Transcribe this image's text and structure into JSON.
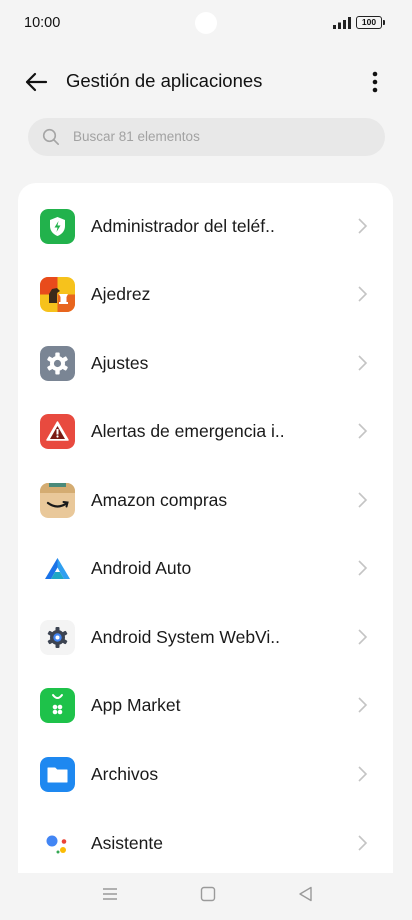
{
  "status": {
    "time": "10:00",
    "battery": "100"
  },
  "header": {
    "title": "Gestión de aplicaciones"
  },
  "search": {
    "placeholder": "Buscar 81 elementos"
  },
  "apps": [
    {
      "label": "Administrador del teléf..",
      "icon": "phone-manager-icon",
      "color": "#22b24c"
    },
    {
      "label": "Ajedrez",
      "icon": "chess-icon",
      "color": "#e8651e"
    },
    {
      "label": "Ajustes",
      "icon": "settings-gear-icon",
      "color": "#7a8594"
    },
    {
      "label": "Alertas de emergencia i..",
      "icon": "emergency-alert-icon",
      "color": "#e84a3f"
    },
    {
      "label": "Amazon compras",
      "icon": "amazon-icon",
      "color": "#e9c89a"
    },
    {
      "label": "Android Auto",
      "icon": "android-auto-icon",
      "color": "#1a73e8"
    },
    {
      "label": "Android System WebVi..",
      "icon": "webview-gear-icon",
      "color": "#4285f4"
    },
    {
      "label": "App Market",
      "icon": "app-market-icon",
      "color": "#1ec24a"
    },
    {
      "label": "Archivos",
      "icon": "folder-icon",
      "color": "#1e88f0"
    },
    {
      "label": "Asistente",
      "icon": "assistant-icon",
      "color": "#4285f4"
    }
  ]
}
